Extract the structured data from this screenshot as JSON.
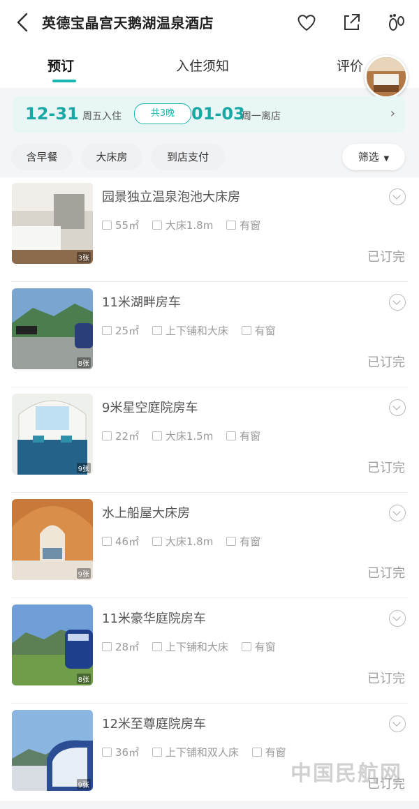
{
  "header": {
    "title": "英德宝晶宫天鹅湖温泉酒店"
  },
  "tabs": [
    {
      "label": "预订",
      "active": true
    },
    {
      "label": "入住须知",
      "active": false
    },
    {
      "label": "评价",
      "active": false
    }
  ],
  "dates": {
    "checkin_date": "12-31",
    "checkin_day": "周五入住",
    "nights": "共3晚",
    "checkout_date": "01-03",
    "checkout_day": "周一离店"
  },
  "filters": {
    "chips": [
      "含早餐",
      "大床房",
      "到店支付"
    ],
    "screen_label": "筛选"
  },
  "rooms": [
    {
      "name": "园景独立温泉泡池大床房",
      "area": "55㎡",
      "bed": "大床1.8m",
      "window": "有窗",
      "status": "已订完",
      "photo_count": "3张"
    },
    {
      "name": "11米湖畔房车",
      "area": "25㎡",
      "bed": "上下铺和大床",
      "window": "有窗",
      "status": "已订完",
      "photo_count": "8张"
    },
    {
      "name": "9米星空庭院房车",
      "area": "22㎡",
      "bed": "大床1.5m",
      "window": "有窗",
      "status": "已订完",
      "photo_count": "9张"
    },
    {
      "name": "水上船屋大床房",
      "area": "46㎡",
      "bed": "大床1.8m",
      "window": "有窗",
      "status": "已订完",
      "photo_count": "9张"
    },
    {
      "name": "11米豪华庭院房车",
      "area": "28㎡",
      "bed": "上下铺和大床",
      "window": "有窗",
      "status": "已订完",
      "photo_count": "8张"
    },
    {
      "name": "12米至尊庭院房车",
      "area": "36㎡",
      "bed": "上下铺和双人床",
      "window": "有窗",
      "status": "已订完",
      "photo_count": "9张"
    }
  ],
  "watermark": "中国民航网",
  "colors": {
    "accent": "#19b7b1",
    "sold_out": "#9e9e9e"
  },
  "icons": [
    "back-arrow-icon",
    "heart-icon",
    "share-icon",
    "footprint-icon",
    "chevron-right-icon",
    "chevron-down-icon",
    "expand-icon",
    "area-icon",
    "bed-icon",
    "window-icon"
  ]
}
